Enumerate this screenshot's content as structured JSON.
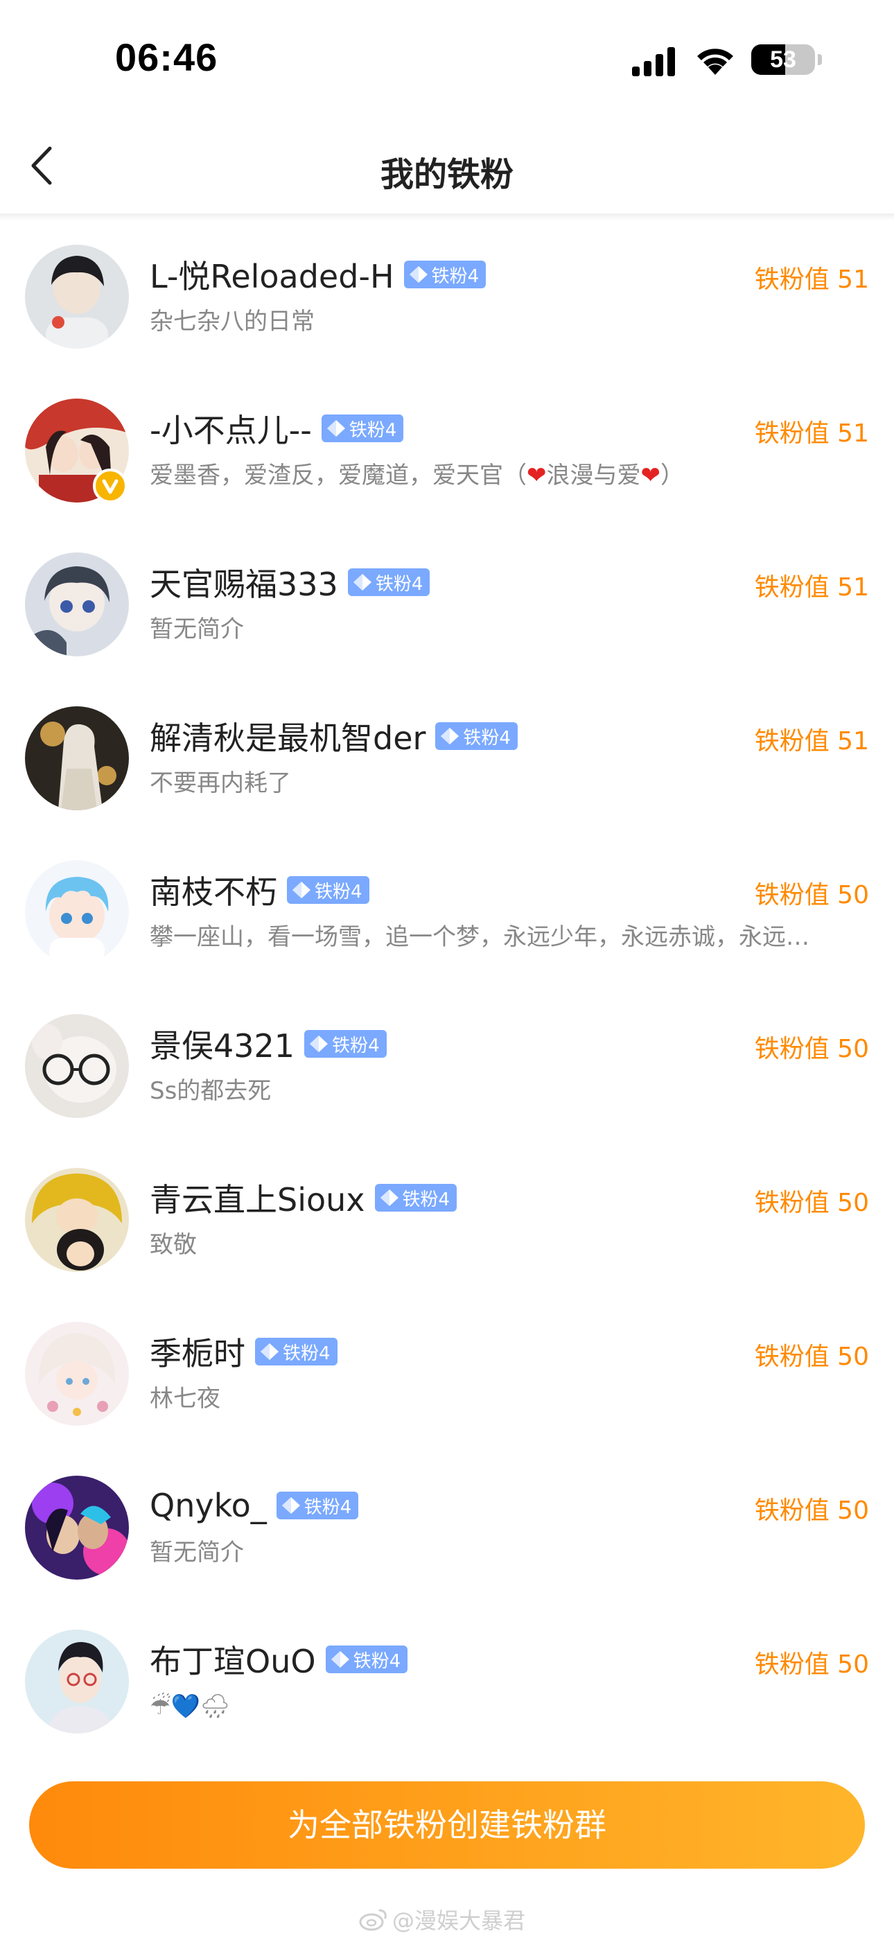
{
  "status_bar": {
    "time": "06:46",
    "battery": "53",
    "battery_level": 0.53
  },
  "nav": {
    "title": "我的铁粉"
  },
  "fans": [
    {
      "name": "L-悦Reloaded-H",
      "badge": "铁粉4",
      "score": "铁粉值 51",
      "bio": "杂七杂八的日常",
      "verified": false
    },
    {
      "name": "-小不点儿--",
      "badge": "铁粉4",
      "score": "铁粉值 51",
      "bio_parts": [
        "爱墨香，爱渣反，爱魔道，爱天官（",
        "❤",
        "浪漫与爱",
        "❤",
        "）"
      ],
      "verified": true
    },
    {
      "name": "天官赐福333",
      "badge": "铁粉4",
      "score": "铁粉值 51",
      "bio": "暂无简介",
      "verified": false
    },
    {
      "name": "解清秋是最机智der",
      "badge": "铁粉4",
      "score": "铁粉值 51",
      "bio": "不要再内耗了",
      "verified": false
    },
    {
      "name": "南枝不朽",
      "badge": "铁粉4",
      "score": "铁粉值 50",
      "bio": "攀一座山，看一场雪，追一个梦，永远少年，永远赤诚，永远…",
      "verified": false
    },
    {
      "name": "景俣4321",
      "badge": "铁粉4",
      "score": "铁粉值 50",
      "bio": "Ss的都去死",
      "verified": false
    },
    {
      "name": "青云直上Sioux",
      "badge": "铁粉4",
      "score": "铁粉值 50",
      "bio": "致敬",
      "verified": false
    },
    {
      "name": "季栀时",
      "badge": "铁粉4",
      "score": "铁粉值 50",
      "bio": "林七夜",
      "verified": false
    },
    {
      "name": "Qnyko_",
      "badge": "铁粉4",
      "score": "铁粉值 50",
      "bio": "暂无简介",
      "verified": false
    },
    {
      "name": "布丁瑄OuO",
      "badge": "铁粉4",
      "score": "铁粉值 50",
      "bio": "☔💙🌧",
      "verified": false
    }
  ],
  "bottom": {
    "create_button": "为全部铁粉创建铁粉群",
    "watermark": "@漫娱大暴君"
  },
  "colors": {
    "accent": "#ff8a00",
    "badge": "#7aa9ff",
    "button_start": "#ff8a0b",
    "button_end": "#ffb52a"
  }
}
